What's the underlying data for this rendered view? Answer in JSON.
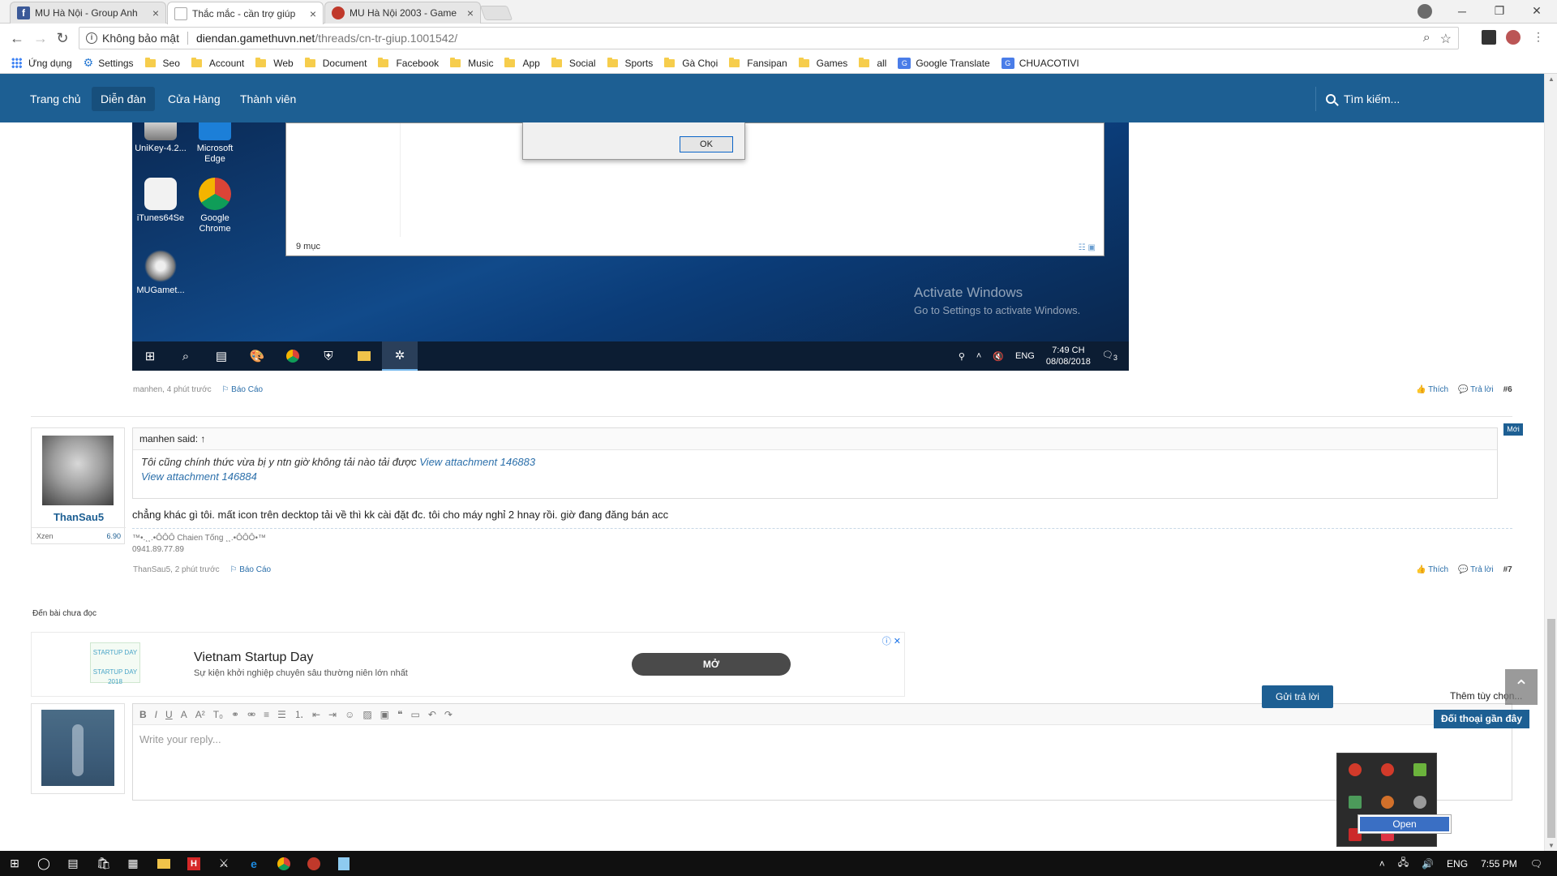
{
  "tabs": [
    {
      "title": "MU Hà Nội - Group Anh",
      "active": false,
      "color": "#3b5998"
    },
    {
      "title": "Thắc mắc - cần trợ giúp",
      "active": true,
      "color": "#ffffff"
    },
    {
      "title": "MU Hà Nội 2003 - Game",
      "active": false,
      "color": "#c0392b"
    }
  ],
  "address": {
    "security_label": "Không bảo mật",
    "host": "diendan.gamethuvn.net",
    "path": "/threads/cn-tr-giup.1001542/"
  },
  "bookmarks": [
    {
      "label": "Ứng dụng",
      "icon": "apps-icon"
    },
    {
      "label": "Settings",
      "icon": "gear-icon"
    },
    {
      "label": "Seo",
      "icon": "folder-icon"
    },
    {
      "label": "Account",
      "icon": "folder-icon"
    },
    {
      "label": "Web",
      "icon": "folder-icon"
    },
    {
      "label": "Document",
      "icon": "folder-icon"
    },
    {
      "label": "Facebook",
      "icon": "folder-icon"
    },
    {
      "label": "Music",
      "icon": "folder-icon"
    },
    {
      "label": "App",
      "icon": "folder-icon"
    },
    {
      "label": "Social",
      "icon": "folder-icon"
    },
    {
      "label": "Sports",
      "icon": "folder-icon"
    },
    {
      "label": "Gà Chọi",
      "icon": "folder-icon"
    },
    {
      "label": "Fansipan",
      "icon": "folder-icon"
    },
    {
      "label": "Games",
      "icon": "folder-icon"
    },
    {
      "label": "all",
      "icon": "folder-icon"
    },
    {
      "label": "Google Translate",
      "icon": "translate-icon"
    },
    {
      "label": "CHUACOTIVI",
      "icon": "translate-icon"
    }
  ],
  "nav": {
    "items": [
      "Trang chủ",
      "Diễn đàn",
      "Cửa Hàng",
      "Thành viên"
    ],
    "active": "Diễn đàn",
    "search": "Tìm kiếm..."
  },
  "screenshot": {
    "desktop_icons": [
      "UniKey-4.2...",
      "Microsoft Edge",
      "iTunes64Se",
      "Google Chrome",
      "MUGamet..."
    ],
    "explorer_status": "9 mục",
    "ok_label": "OK",
    "activate_title": "Activate Windows",
    "activate_sub": "Go to Settings to activate Windows.",
    "lang": "ENG",
    "time": "7:49 CH",
    "date": "08/08/2018",
    "notif_count": "3"
  },
  "post6": {
    "meta": "manhen, 4 phút trước",
    "report": "Báo Cáo",
    "like": "Thích",
    "reply": "Trả lời",
    "number": "#6"
  },
  "post7": {
    "username": "ThanSau5",
    "user_field": "Xzen",
    "user_value": "6.90",
    "new_badge": "Mới",
    "quote_header": "manhen said: ↑",
    "quote_text": "Tôi cũng chính thức vừa bị y ntn giờ không tải nào tải được",
    "quote_link1": "View attachment 146883",
    "quote_link2": "View attachment 146884",
    "message": "chẳng khác gì tôi. mất icon trên decktop tải về thì kk cài đặt đc. tôi cho máy nghỉ 2 hnay rồi. giờ đang đăng bán acc",
    "sig_line1": "™•.¸¸.•ÔÔÔ Chaien Tống ¸¸.•ÔÔÔ•™",
    "sig_line2": "0941.89.77.89",
    "meta": "ThanSau5, 2 phút trước",
    "report": "Báo Cáo",
    "like": "Thích",
    "reply": "Trả lời",
    "number": "#7"
  },
  "unread_link": "Đến bài chưa đọc",
  "ad": {
    "logo_text": "STARTUP DAY",
    "logo_sub": "STARTUP DAY 2018",
    "headline": "Vietnam Startup Day",
    "subline": "Sự kiện khởi nghiệp chuyên sâu thường niên lớn nhất",
    "cta": "MỞ"
  },
  "reply": {
    "placeholder": "Write your reply...",
    "submit": "Gửi trả lời",
    "more_options": "Thêm tùy chọn...",
    "recent": "Đối thoại gần đây",
    "context_open": "Open"
  },
  "taskbar": {
    "lang": "ENG",
    "time": "7:55 PM"
  }
}
